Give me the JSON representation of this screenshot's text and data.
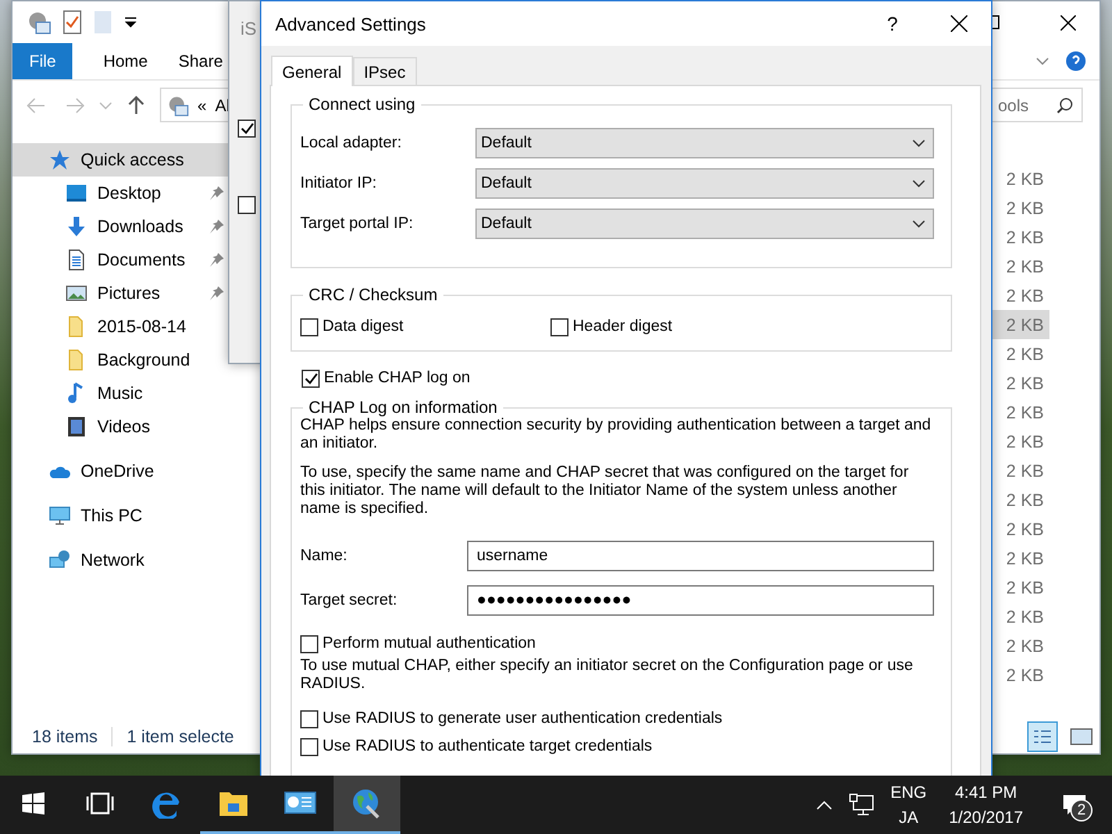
{
  "explorer": {
    "ribbon_tabs": [
      {
        "label": "File",
        "kind": "file"
      },
      {
        "label": "Home",
        "kind": "tab"
      },
      {
        "label": "Share",
        "kind": "tab"
      }
    ],
    "address_prefix": "«",
    "address": "Al",
    "search_placeholder": "ools",
    "nav": [
      {
        "label": "Quick access",
        "kind": "star",
        "selected": true,
        "children": [
          {
            "label": "Desktop",
            "kind": "desktop",
            "selected": false,
            "pinned": true
          },
          {
            "label": "Downloads",
            "kind": "download",
            "selected": false,
            "pinned": true
          },
          {
            "label": "Documents",
            "kind": "document",
            "selected": false,
            "pinned": true
          },
          {
            "label": "Pictures",
            "kind": "picture",
            "selected": false,
            "pinned": true
          },
          {
            "label": "2015-08-14",
            "kind": "folder",
            "selected": false,
            "pinned": false
          },
          {
            "label": "Background",
            "kind": "folder",
            "selected": false,
            "pinned": false
          },
          {
            "label": "Music",
            "kind": "music",
            "selected": false,
            "pinned": false
          },
          {
            "label": "Videos",
            "kind": "video",
            "selected": false,
            "pinned": false
          }
        ]
      },
      {
        "label": "OneDrive",
        "kind": "cloud",
        "selected": false
      },
      {
        "label": "This PC",
        "kind": "pc",
        "selected": false
      },
      {
        "label": "Network",
        "kind": "network",
        "selected": false
      }
    ],
    "files": [
      {
        "size": "2 KB",
        "selected": false
      },
      {
        "size": "2 KB",
        "selected": false
      },
      {
        "size": "2 KB",
        "selected": false
      },
      {
        "size": "2 KB",
        "selected": false
      },
      {
        "size": "2 KB",
        "selected": false
      },
      {
        "size": "2 KB",
        "selected": true
      },
      {
        "size": "2 KB",
        "selected": false
      },
      {
        "size": "2 KB",
        "selected": false
      },
      {
        "size": "2 KB",
        "selected": false
      },
      {
        "size": "2 KB",
        "selected": false
      },
      {
        "size": "2 KB",
        "selected": false
      },
      {
        "size": "2 KB",
        "selected": false
      },
      {
        "size": "2 KB",
        "selected": false
      },
      {
        "size": "2 KB",
        "selected": false
      },
      {
        "size": "2 KB",
        "selected": false
      },
      {
        "size": "2 KB",
        "selected": false
      },
      {
        "size": "2 KB",
        "selected": false
      },
      {
        "size": "2 KB",
        "selected": false
      }
    ],
    "status": {
      "count": "18 items",
      "selection": "1 item selecte"
    }
  },
  "behind_window": {
    "title": "iS",
    "checkboxes": [
      {
        "checked": true
      },
      {
        "checked": false
      }
    ]
  },
  "dialog": {
    "title": "Advanced Settings",
    "help_glyph": "?",
    "tabs": [
      {
        "label": "General",
        "selected": true
      },
      {
        "label": "IPsec",
        "selected": false
      }
    ],
    "connect_group": {
      "title": "Connect using",
      "rows": [
        {
          "label": "Local adapter:",
          "value": "Default"
        },
        {
          "label": "Initiator IP:",
          "value": "Default"
        },
        {
          "label": "Target portal IP:",
          "value": "Default"
        }
      ]
    },
    "crc_group": {
      "title": "CRC / Checksum",
      "options": [
        {
          "label": "Data digest",
          "checked": false
        },
        {
          "label": "Header digest",
          "checked": false
        }
      ]
    },
    "chap_enable": {
      "label": "Enable CHAP log on",
      "checked": true
    },
    "chap_group": {
      "title": "CHAP Log on information",
      "intro": "CHAP helps ensure connection security by providing authentication between a target and an initiator.",
      "details": "To use, specify the same name and CHAP secret that was configured on the target for this initiator.  The name will default to the Initiator Name of the system unless another name is specified.",
      "name": {
        "label": "Name:",
        "value": "username"
      },
      "secret": {
        "label": "Target secret:",
        "value": "●●●●●●●●●●●●●●●●"
      },
      "mutual": {
        "label": "Perform mutual authentication",
        "checked": false
      },
      "mutual_note": "To use mutual CHAP, either specify an initiator secret on the Configuration page or use RADIUS.",
      "radius": [
        {
          "label": "Use RADIUS to generate user authentication credentials",
          "checked": false
        },
        {
          "label": "Use RADIUS to authenticate target credentials",
          "checked": false
        }
      ]
    }
  },
  "taskbar": {
    "apps": [
      {
        "kind": "task-view",
        "active": false,
        "open": false
      },
      {
        "kind": "edge",
        "active": false,
        "open": false
      },
      {
        "kind": "explorer",
        "active": false,
        "open": true
      },
      {
        "kind": "iscsi",
        "active": false,
        "open": true
      },
      {
        "kind": "globe",
        "active": true,
        "open": true
      }
    ],
    "languages": [
      "ENG",
      "JA"
    ],
    "time": "4:41 PM",
    "date": "1/20/2017",
    "notifications": "2"
  }
}
